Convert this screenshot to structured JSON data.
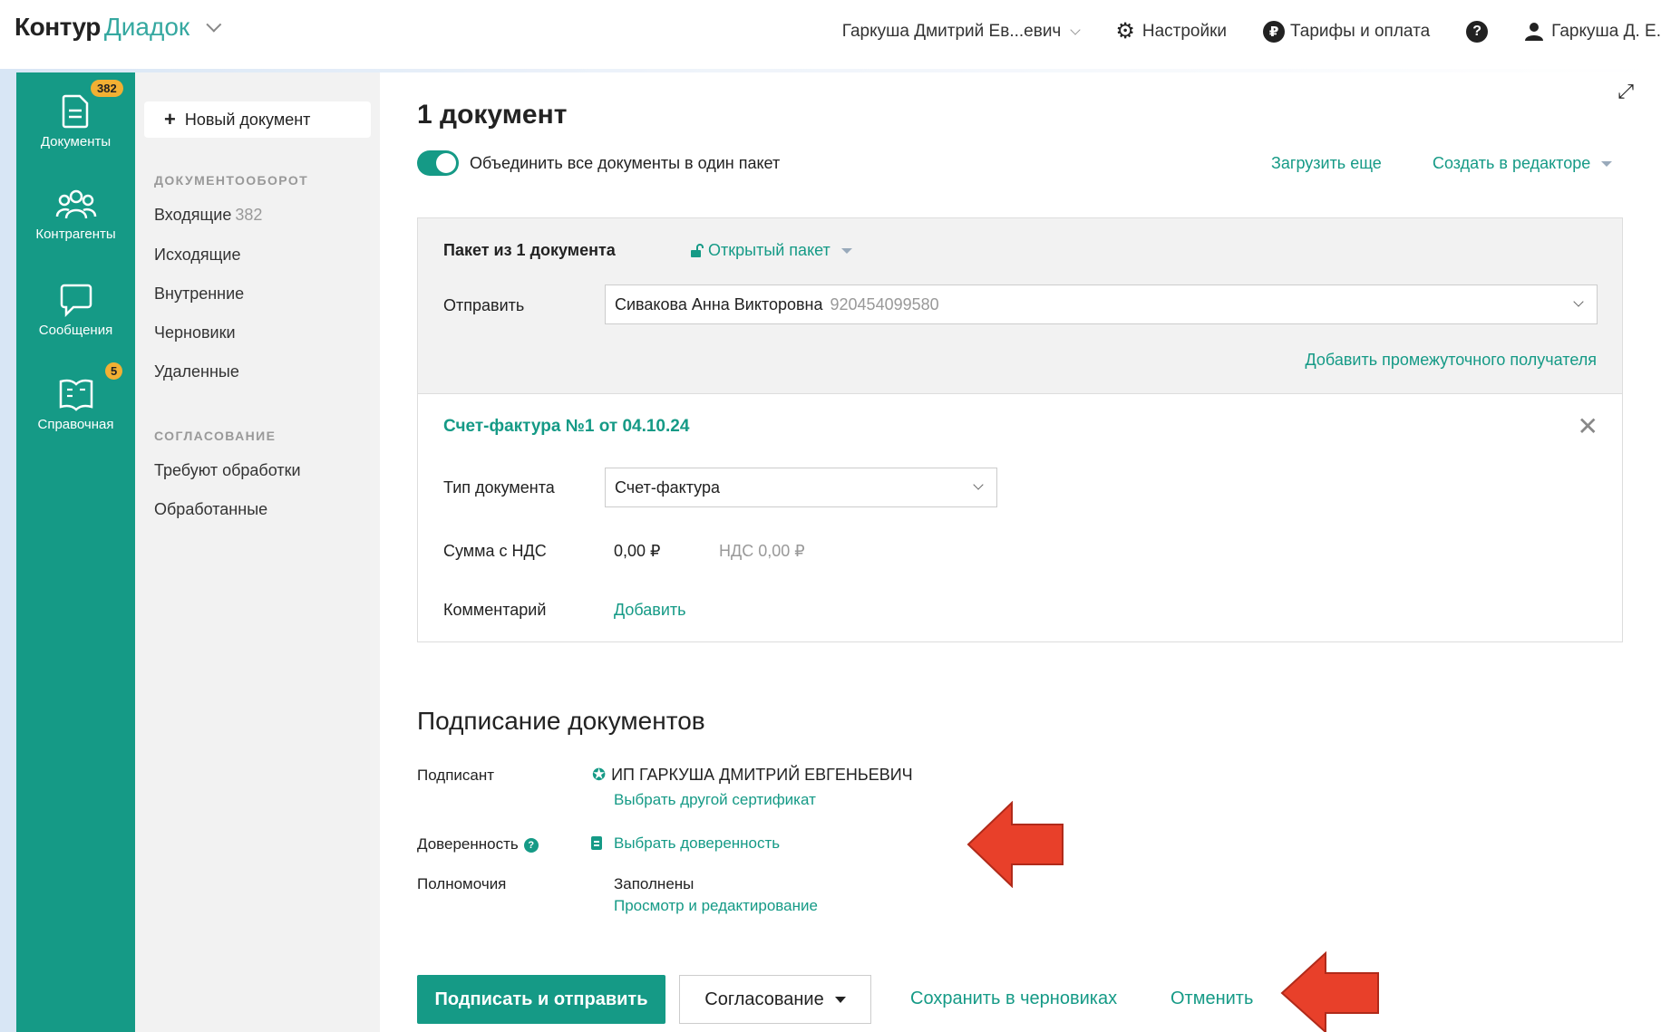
{
  "header": {
    "logo_kontur": "Контур",
    "logo_diadoc": "Диадок",
    "org_selector": "Гаркуша Дмитрий Ев...евич",
    "settings": "Настройки",
    "tariffs": "Тарифы и оплата",
    "user": "Гаркуша Д. Е."
  },
  "nav": {
    "documents": {
      "label": "Документы",
      "badge": "382"
    },
    "contractors": {
      "label": "Контрагенты"
    },
    "messages": {
      "label": "Сообщения"
    },
    "reference": {
      "label": "Справочная",
      "badge": "5"
    }
  },
  "subnav": {
    "new_document": "Новый документ",
    "section_docflow": "ДОКУМЕНТООБОРОТ",
    "incoming": "Входящие",
    "incoming_count": "382",
    "outgoing": "Исходящие",
    "internal": "Внутренние",
    "drafts": "Черновики",
    "deleted": "Удаленные",
    "section_approval": "СОГЛАСОВАНИЕ",
    "need_processing": "Требуют обработки",
    "processed": "Обработанные"
  },
  "main": {
    "title": "1 документ",
    "merge_toggle_label": "Объединить все документы в один пакет",
    "merge_toggle_on": true,
    "upload_more": "Загрузить еще",
    "create_in_editor": "Создать в редакторе",
    "package": {
      "title": "Пакет из 1 документа",
      "type": "Открытый пакет",
      "send_label": "Отправить",
      "recipient_name": "Сивакова Анна Викторовна",
      "recipient_inn": "920454099580",
      "add_intermediate": "Добавить промежуточного получателя"
    },
    "document": {
      "title": "Счет-фактура №1 от 04.10.24",
      "type_label": "Тип документа",
      "type_value": "Счет-фактура",
      "sum_label": "Сумма с НДС",
      "sum_value": "0,00 ₽",
      "vat_value": "НДС 0,00 ₽",
      "comment_label": "Комментарий",
      "comment_add": "Добавить"
    },
    "signing": {
      "heading": "Подписание документов",
      "signer_label": "Подписант",
      "signer_name": "ИП ГАРКУША ДМИТРИЙ ЕВГЕНЬЕВИЧ",
      "choose_cert": "Выбрать другой сертификат",
      "poa_label": "Доверенность",
      "choose_poa": "Выбрать доверенность",
      "powers_label": "Полномочия",
      "powers_value": "Заполнены",
      "powers_edit": "Просмотр и редактирование"
    },
    "actions": {
      "sign_send": "Подписать и отправить",
      "approval": "Согласование",
      "save_draft": "Сохранить в черновиках",
      "cancel": "Отменить"
    }
  },
  "colors": {
    "accent": "#159a86",
    "badge": "#f2b033",
    "arrow": "#e8402a"
  }
}
